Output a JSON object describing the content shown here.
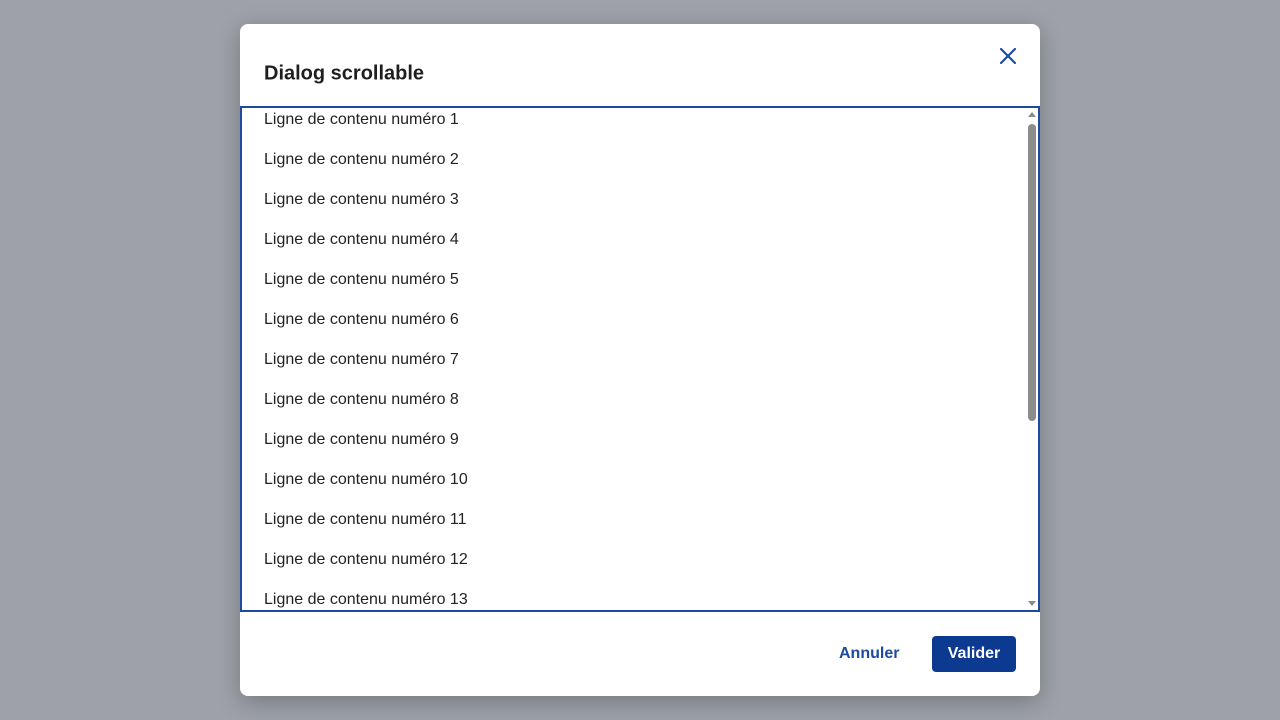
{
  "dialog": {
    "title": "Dialog scrollable",
    "close_icon": "close-icon",
    "accent_color": "#1c4ba0",
    "primary_color": "#0d3a91",
    "overlay_color": "#9ea1a9"
  },
  "content": {
    "rows": [
      "Ligne de contenu numéro 1",
      "Ligne de contenu numéro 2",
      "Ligne de contenu numéro 3",
      "Ligne de contenu numéro 4",
      "Ligne de contenu numéro 5",
      "Ligne de contenu numéro 6",
      "Ligne de contenu numéro 7",
      "Ligne de contenu numéro 8",
      "Ligne de contenu numéro 9",
      "Ligne de contenu numéro 10",
      "Ligne de contenu numéro 11",
      "Ligne de contenu numéro 12",
      "Ligne de contenu numéro 13"
    ]
  },
  "footer": {
    "cancel_label": "Annuler",
    "validate_label": "Valider"
  }
}
